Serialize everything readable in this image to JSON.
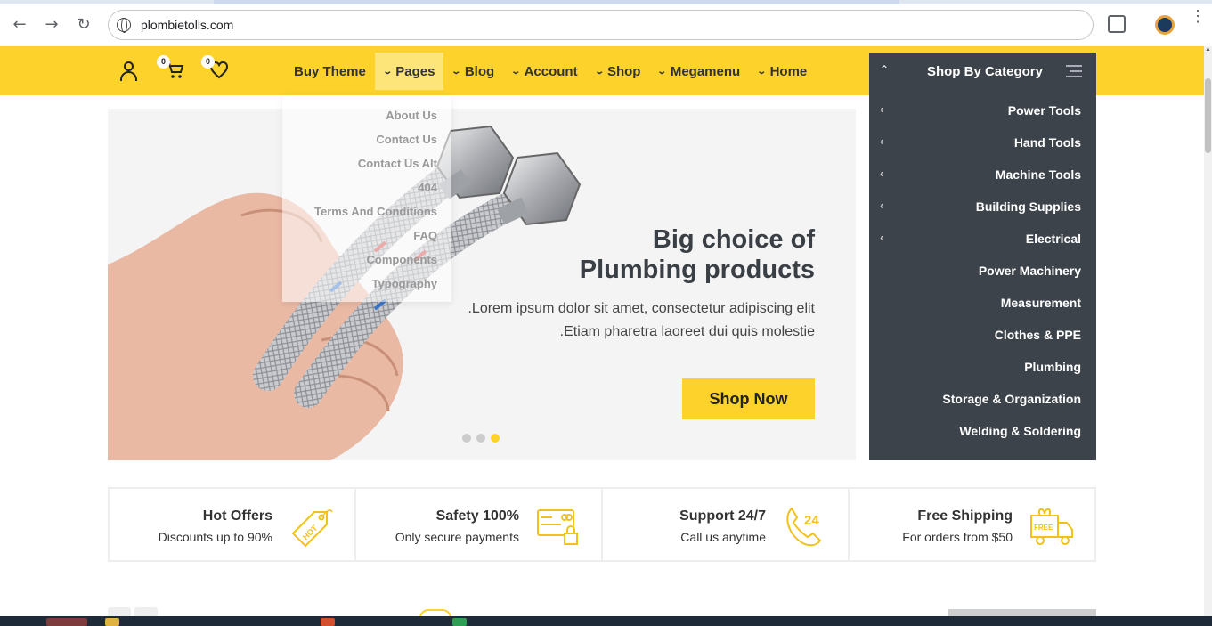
{
  "browser": {
    "url": "plombietolls.com",
    "back_icon": "arrow-left-icon",
    "forward_icon": "arrow-right-icon",
    "reload_icon": "reload-icon"
  },
  "header": {
    "cart_count": "0",
    "wishlist_count": "0",
    "menu": [
      {
        "label": "Buy Theme",
        "has_chevron": false,
        "active": false
      },
      {
        "label": "Pages",
        "has_chevron": true,
        "active": true
      },
      {
        "label": "Blog",
        "has_chevron": true,
        "active": false
      },
      {
        "label": "Account",
        "has_chevron": true,
        "active": false
      },
      {
        "label": "Shop",
        "has_chevron": true,
        "active": false
      },
      {
        "label": "Megamenu",
        "has_chevron": true,
        "active": false
      },
      {
        "label": "Home",
        "has_chevron": true,
        "active": false
      }
    ],
    "accent_color": "#fdd22b"
  },
  "pages_dropdown": [
    "About Us",
    "Contact Us",
    "Contact Us Alt",
    "404",
    "Terms And Conditions",
    "FAQ",
    "Components",
    "Typography"
  ],
  "category": {
    "title": "Shop By Category",
    "items": [
      {
        "label": "Power Tools",
        "has_sub": true
      },
      {
        "label": "Hand Tools",
        "has_sub": true
      },
      {
        "label": "Machine Tools",
        "has_sub": true
      },
      {
        "label": "Building Supplies",
        "has_sub": true
      },
      {
        "label": "Electrical",
        "has_sub": true
      },
      {
        "label": "Power Machinery",
        "has_sub": false
      },
      {
        "label": "Measurement",
        "has_sub": false
      },
      {
        "label": "Clothes & PPE",
        "has_sub": false
      },
      {
        "label": "Plumbing",
        "has_sub": false
      },
      {
        "label": "Storage & Organization",
        "has_sub": false
      },
      {
        "label": "Welding & Soldering",
        "has_sub": false
      }
    ],
    "bg_color": "#3d434a"
  },
  "hero": {
    "title_line1": "Big choice of",
    "title_line2": "Plumbing products",
    "text_line1": ".Lorem ipsum dolor sit amet, consectetur adipiscing elit",
    "text_line2": ".Etiam pharetra laoreet dui quis molestie",
    "button": "Shop Now",
    "slide_count": 3,
    "active_slide": 3
  },
  "features": [
    {
      "title": "Hot Offers",
      "subtitle": "Discounts up to 90%",
      "icon": "price-tag-icon"
    },
    {
      "title": "Safety 100%",
      "subtitle": "Only secure payments",
      "icon": "secure-card-icon"
    },
    {
      "title": "Support 24/7",
      "subtitle": "Call us anytime",
      "icon": "phone-24-icon"
    },
    {
      "title": "Free Shipping",
      "subtitle": "For orders from $50",
      "icon": "delivery-truck-icon"
    }
  ]
}
